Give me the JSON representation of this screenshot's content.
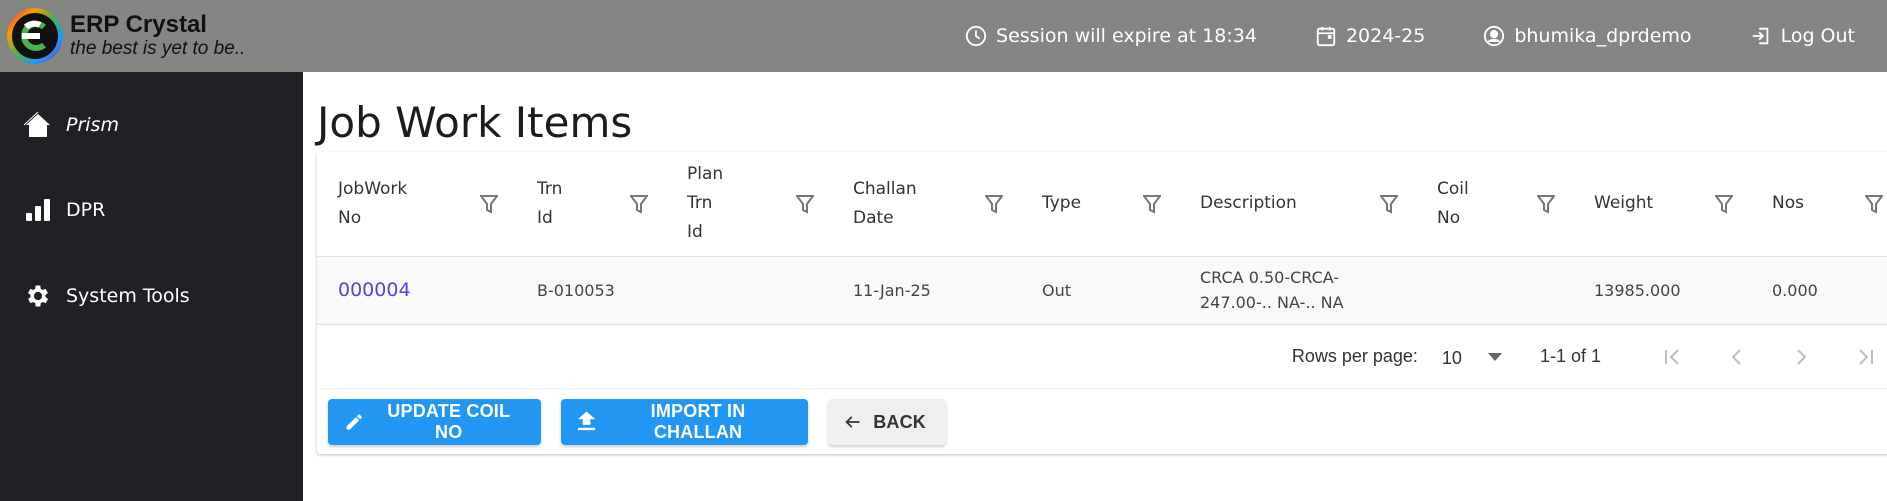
{
  "app": {
    "title": "ERP Crystal",
    "tagline": "the best is yet to be.."
  },
  "topnav": {
    "session": {
      "icon": "clock-icon",
      "label": "Session will expire at 18:34"
    },
    "year": {
      "icon": "calendar-icon",
      "label": "2024-25"
    },
    "user": {
      "icon": "user-circle-icon",
      "label": "bhumika_dprdemo"
    },
    "logout": {
      "icon": "logout-icon",
      "label": "Log Out"
    }
  },
  "sidebar": {
    "items": [
      {
        "icon": "home-icon",
        "label": "Prism"
      },
      {
        "icon": "bar-chart-icon",
        "label": "DPR"
      },
      {
        "icon": "gear-icon",
        "label": "System Tools"
      }
    ]
  },
  "page": {
    "title": "Job Work Items"
  },
  "table": {
    "columns": [
      {
        "label": "JobWork No"
      },
      {
        "label": "Trn Id"
      },
      {
        "label": "Plan Trn Id"
      },
      {
        "label": "Challan Date"
      },
      {
        "label": "Type"
      },
      {
        "label": "Description"
      },
      {
        "label": "Coil No"
      },
      {
        "label": "Weight"
      },
      {
        "label": "Nos"
      }
    ],
    "rows": [
      {
        "jobwork_no": "000004",
        "trn_id": "B-010053",
        "plan_trn_id": "",
        "challan_date": "11-Jan-25",
        "type": "Out",
        "description": "CRCA 0.50-CRCA-247.00-.. NA-.. NA",
        "coil_no": "",
        "weight": "13985.000",
        "nos": "0.000"
      }
    ]
  },
  "pagination": {
    "rows_per_page_label": "Rows per page:",
    "rows_per_page": "10",
    "range": "1-1 of 1"
  },
  "actions": {
    "update_coil": "UPDATE COIL NO",
    "import_challan": "IMPORT IN CHALLAN",
    "back": "BACK"
  },
  "colors": {
    "topbar": "#838682",
    "sidebar": "#202124",
    "primary": "#2196f3",
    "link": "#5b3fe0"
  }
}
